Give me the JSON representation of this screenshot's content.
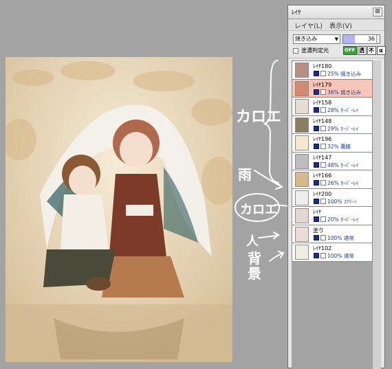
{
  "panel": {
    "title": "ﾚｲﾔ",
    "close_glyph": "⊠",
    "menu": [
      "レイヤ(L)",
      "表示(V)"
    ]
  },
  "controls": {
    "blend_mode": "焼き込み",
    "opacity": "36",
    "opacity_fraction": 0.36,
    "clip_label": "塗濃判定元",
    "mode_buttons": [
      "OFF",
      "透",
      "不",
      "α"
    ]
  },
  "layers": [
    {
      "name": "ﾚｲﾔ180",
      "opacity": "25%",
      "mode": "焼き込み",
      "thumb": "#b98e84",
      "selected": false
    },
    {
      "name": "ﾚｲﾔ179",
      "opacity": "36%",
      "mode": "焼き込み",
      "thumb": "#cf8a70",
      "selected": true
    },
    {
      "name": "ﾚｲﾔ158",
      "opacity": "28%",
      "mode": "ｵｰﾊﾞｰﾚｲ",
      "thumb": "#e6ddd2",
      "selected": false
    },
    {
      "name": "ﾚｲﾔ148",
      "opacity": "29%",
      "mode": "ｵｰﾊﾞｰﾚｲ",
      "thumb": "#8a7e60",
      "selected": false
    },
    {
      "name": "ﾚｲﾔ196",
      "opacity": "32%",
      "mode": "覆膜",
      "thumb": "#f6e8cf",
      "selected": false
    },
    {
      "name": "ﾚｲﾔ147",
      "opacity": "48%",
      "mode": "ｵｰﾊﾞｰﾚｲ",
      "thumb": "#bdbdbd",
      "selected": false
    },
    {
      "name": "ﾚｲﾔ166",
      "opacity": "26%",
      "mode": "ｵｰﾊﾞｰﾚｲ",
      "thumb": "#d8b98c",
      "selected": false
    },
    {
      "name": "ﾚｲﾔ200",
      "opacity": "100%",
      "mode": "ｽｸﾘｰﾝ",
      "thumb": "#eeeeee",
      "selected": false
    },
    {
      "name": "ﾚｲﾔ",
      "opacity": "20%",
      "mode": "ｵｰﾊﾞｰﾚｲ",
      "thumb": "#e5d7cf",
      "selected": false
    },
    {
      "name": "塗り",
      "opacity": "100%",
      "mode": "通常",
      "thumb": "#ecdcd6",
      "selected": false
    },
    {
      "name": "ﾚｲﾔ102",
      "opacity": "100%",
      "mode": "通常",
      "thumb": "#f0ece4",
      "selected": false
    }
  ],
  "annotations": {
    "kakou_top": "カロエ",
    "ame": "雨",
    "kakou_mid": "カロエ",
    "hito": "人",
    "haikei": "背景"
  }
}
